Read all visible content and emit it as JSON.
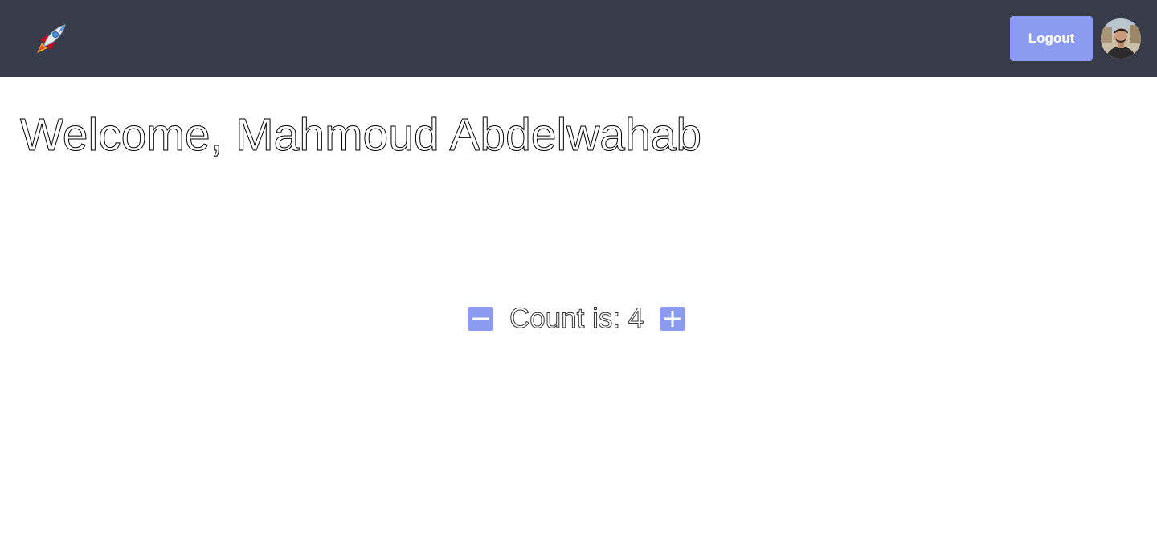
{
  "app": {
    "logo_icon": "rocket-icon"
  },
  "header": {
    "logout_label": "Logout",
    "avatar_alt": "avatar",
    "colors": {
      "background": "#383c4a",
      "accent": "#8b9cf0"
    }
  },
  "main": {
    "welcome_text": "Welcome, Mahmoud Abdelwahab",
    "counter": {
      "text": "Count is: 4",
      "decrement_icon": "minus-icon",
      "increment_icon": "plus-icon"
    }
  }
}
